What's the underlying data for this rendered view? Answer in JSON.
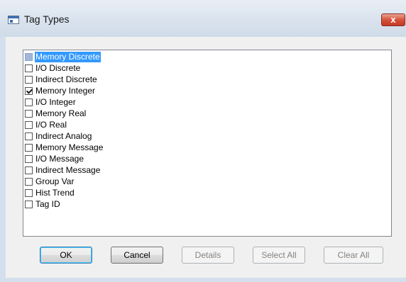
{
  "window": {
    "title": "Tag Types",
    "close_glyph": "x",
    "icon": "window-app-icon"
  },
  "tag_list": {
    "items": [
      {
        "label": "Memory Discrete",
        "checked": false,
        "selected": true
      },
      {
        "label": "I/O Discrete",
        "checked": false,
        "selected": false
      },
      {
        "label": "Indirect Discrete",
        "checked": false,
        "selected": false
      },
      {
        "label": "Memory Integer",
        "checked": true,
        "selected": false
      },
      {
        "label": "I/O Integer",
        "checked": false,
        "selected": false
      },
      {
        "label": "Memory Real",
        "checked": false,
        "selected": false
      },
      {
        "label": "I/O Real",
        "checked": false,
        "selected": false
      },
      {
        "label": "Indirect Analog",
        "checked": false,
        "selected": false
      },
      {
        "label": "Memory Message",
        "checked": false,
        "selected": false
      },
      {
        "label": "I/O Message",
        "checked": false,
        "selected": false
      },
      {
        "label": "Indirect Message",
        "checked": false,
        "selected": false
      },
      {
        "label": "Group Var",
        "checked": false,
        "selected": false
      },
      {
        "label": "Hist Trend",
        "checked": false,
        "selected": false
      },
      {
        "label": "Tag ID",
        "checked": false,
        "selected": false
      }
    ]
  },
  "buttons": {
    "ok": {
      "label": "OK",
      "enabled": true
    },
    "cancel": {
      "label": "Cancel",
      "enabled": true
    },
    "details": {
      "label": "Details",
      "enabled": false
    },
    "select_all": {
      "label": "Select All",
      "enabled": false
    },
    "clear_all": {
      "label": "Clear All",
      "enabled": false
    }
  },
  "colors": {
    "selection": "#3399ff",
    "close_button": "#c8432b"
  }
}
